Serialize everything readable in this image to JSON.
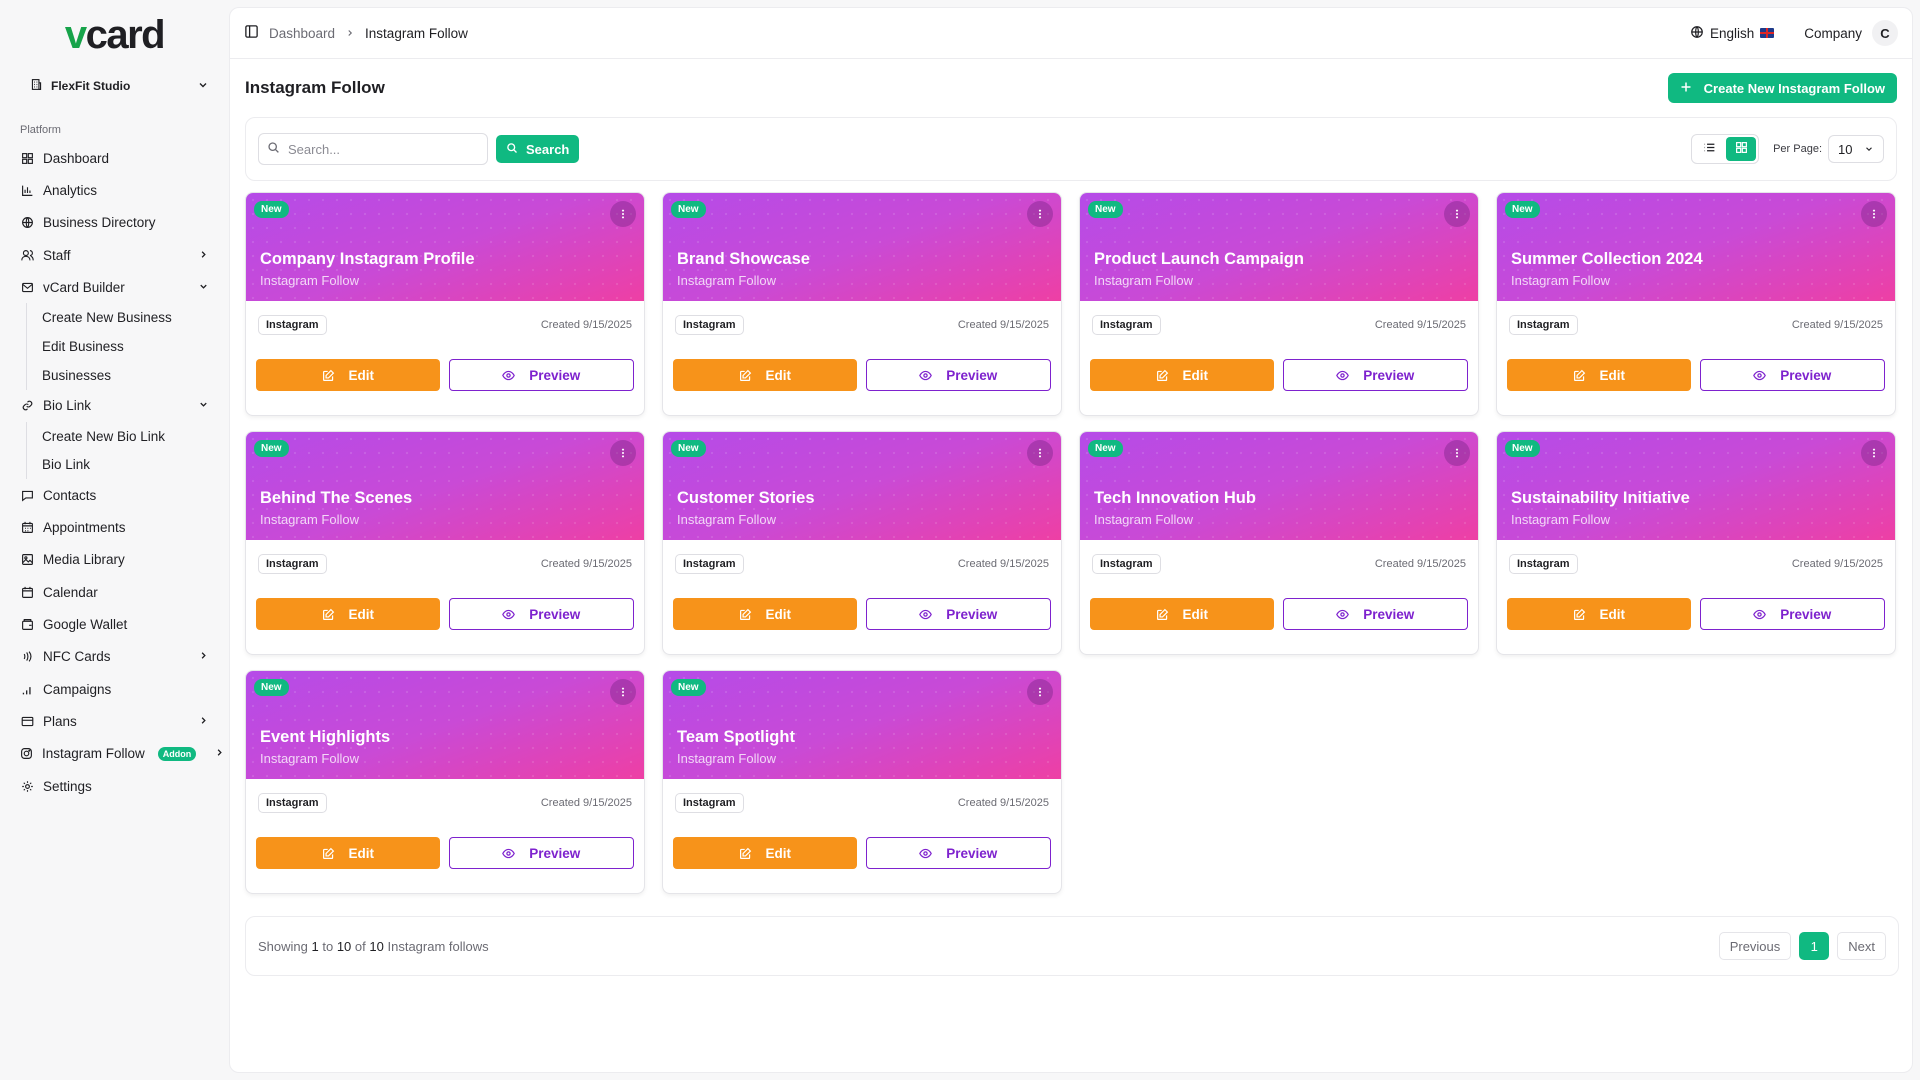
{
  "brand": {
    "logo_v": "v",
    "logo_rest": "card"
  },
  "workspace": {
    "name": "FlexFit Studio"
  },
  "sidebar": {
    "section_label": "Platform",
    "items": [
      {
        "label": "Dashboard"
      },
      {
        "label": "Analytics"
      },
      {
        "label": "Business Directory"
      },
      {
        "label": "Staff"
      },
      {
        "label": "vCard Builder"
      },
      {
        "label": "Bio Link"
      },
      {
        "label": "Contacts"
      },
      {
        "label": "Appointments"
      },
      {
        "label": "Media Library"
      },
      {
        "label": "Calendar"
      },
      {
        "label": "Google Wallet"
      },
      {
        "label": "NFC Cards"
      },
      {
        "label": "Campaigns"
      },
      {
        "label": "Plans"
      },
      {
        "label": "Instagram Follow",
        "badge": "Addon"
      },
      {
        "label": "Settings"
      }
    ],
    "vcard_sub": [
      "Create New Business",
      "Edit Business",
      "Businesses"
    ],
    "biolink_sub": [
      "Create New Bio Link",
      "Bio Link"
    ]
  },
  "topbar": {
    "breadcrumb": [
      "Dashboard",
      "Instagram Follow"
    ],
    "language": "English",
    "company": "Company",
    "avatar_initial": "C"
  },
  "page": {
    "title": "Instagram Follow",
    "create_button": "Create New Instagram Follow"
  },
  "filters": {
    "search_placeholder": "Search...",
    "search_button": "Search",
    "per_page_label": "Per Page:",
    "per_page_value": "10",
    "active_view": "grid"
  },
  "cards": [
    {
      "badge": "New",
      "title": "Company Instagram Profile",
      "subtitle": "Instagram Follow",
      "tag": "Instagram",
      "created": "Created 9/15/2025",
      "edit": "Edit",
      "preview": "Preview"
    },
    {
      "badge": "New",
      "title": "Brand Showcase",
      "subtitle": "Instagram Follow",
      "tag": "Instagram",
      "created": "Created 9/15/2025",
      "edit": "Edit",
      "preview": "Preview"
    },
    {
      "badge": "New",
      "title": "Product Launch Campaign",
      "subtitle": "Instagram Follow",
      "tag": "Instagram",
      "created": "Created 9/15/2025",
      "edit": "Edit",
      "preview": "Preview"
    },
    {
      "badge": "New",
      "title": "Summer Collection 2024",
      "subtitle": "Instagram Follow",
      "tag": "Instagram",
      "created": "Created 9/15/2025",
      "edit": "Edit",
      "preview": "Preview"
    },
    {
      "badge": "New",
      "title": "Behind The Scenes",
      "subtitle": "Instagram Follow",
      "tag": "Instagram",
      "created": "Created 9/15/2025",
      "edit": "Edit",
      "preview": "Preview"
    },
    {
      "badge": "New",
      "title": "Customer Stories",
      "subtitle": "Instagram Follow",
      "tag": "Instagram",
      "created": "Created 9/15/2025",
      "edit": "Edit",
      "preview": "Preview"
    },
    {
      "badge": "New",
      "title": "Tech Innovation Hub",
      "subtitle": "Instagram Follow",
      "tag": "Instagram",
      "created": "Created 9/15/2025",
      "edit": "Edit",
      "preview": "Preview"
    },
    {
      "badge": "New",
      "title": "Sustainability Initiative",
      "subtitle": "Instagram Follow",
      "tag": "Instagram",
      "created": "Created 9/15/2025",
      "edit": "Edit",
      "preview": "Preview"
    },
    {
      "badge": "New",
      "title": "Event Highlights",
      "subtitle": "Instagram Follow",
      "tag": "Instagram",
      "created": "Created 9/15/2025",
      "edit": "Edit",
      "preview": "Preview"
    },
    {
      "badge": "New",
      "title": "Team Spotlight",
      "subtitle": "Instagram Follow",
      "tag": "Instagram",
      "created": "Created 9/15/2025",
      "edit": "Edit",
      "preview": "Preview"
    }
  ],
  "pagination": {
    "showing_prefix": "Showing",
    "from": "1",
    "to_word": "to",
    "to": "10",
    "of_word": "of",
    "total": "10",
    "suffix": "Instagram follows",
    "previous": "Previous",
    "current_page": "1",
    "next": "Next"
  },
  "colors": {
    "accent": "#10b981",
    "edit": "#f7931a",
    "preview": "#7e22ce",
    "banner_start": "#b54be8",
    "banner_end": "#ee3fa4"
  }
}
